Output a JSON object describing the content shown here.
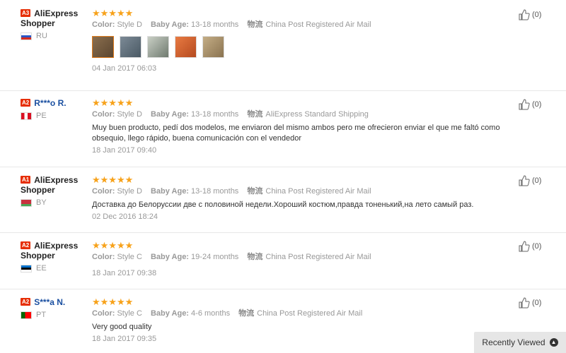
{
  "labels": {
    "color": "Color:",
    "baby_age": "Baby Age:",
    "ship_icon": "物流"
  },
  "reviews": [
    {
      "level": "A3",
      "name": "AliExpress Shopper",
      "country": "RU",
      "stars": "★★★★★",
      "color": "Style D",
      "baby_age": "13-18 months",
      "shipping": "China Post Registered Air Mail",
      "text": "",
      "date": "04 Jan 2017 06:03",
      "likes": "(0)"
    },
    {
      "level": "A2",
      "name": "R***o R.",
      "country": "PE",
      "stars": "★★★★★",
      "color": "Style D",
      "baby_age": "13-18 months",
      "shipping": "AliExpress Standard Shipping",
      "text": "Muy buen producto, pedí dos modelos, me enviaron del mismo ambos pero me ofrecieron enviar el que me faltó como obsequio, llego rápido, buena comunicación con el vendedor",
      "date": "18 Jan 2017 09:40",
      "likes": "(0)"
    },
    {
      "level": "A1",
      "name": "AliExpress Shopper",
      "country": "BY",
      "stars": "★★★★★",
      "color": "Style D",
      "baby_age": "13-18 months",
      "shipping": "China Post Registered Air Mail",
      "text": "Доставка до Белоруссии две с половиной недели.Хороший костюм,правда тоненький,на лето самый раз.",
      "date": "02 Dec 2016 18:24",
      "likes": "(0)"
    },
    {
      "level": "A2",
      "name": "AliExpress Shopper",
      "country": "EE",
      "stars": "★★★★★",
      "color": "Style C",
      "baby_age": "19-24 months",
      "shipping": "China Post Registered Air Mail",
      "text": "",
      "date": "18 Jan 2017 09:38",
      "likes": "(0)"
    },
    {
      "level": "A2",
      "name": "S***a N.",
      "country": "PT",
      "stars": "★★★★★",
      "color": "Style C",
      "baby_age": "4-6 months",
      "shipping": "China Post Registered Air Mail",
      "text": "Very good quality",
      "date": "18 Jan 2017 09:35",
      "likes": "(0)"
    }
  ],
  "recently_viewed": "Recently Viewed",
  "colors": {
    "accent": "#e62e04",
    "star": "#f7a21b"
  }
}
